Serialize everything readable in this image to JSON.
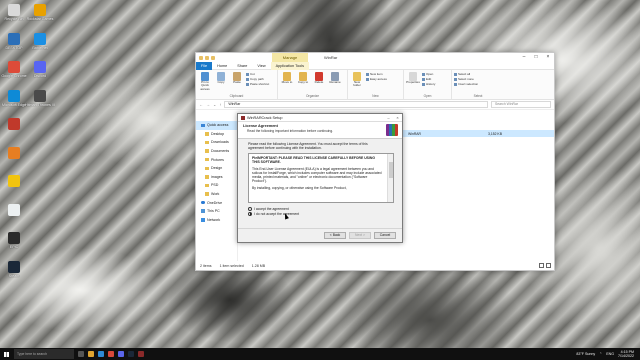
{
  "desktop": {
    "icons": [
      {
        "label": "Recycle Bin",
        "color": "#d9d9d9"
      },
      {
        "label": "Rockstar Games",
        "color": "#e8a100"
      },
      {
        "label": "DESKTOP",
        "color": "#2c6fb8"
      },
      {
        "label": "Battle.net",
        "color": "#1a8fe3"
      },
      {
        "label": "Google Chrome",
        "color": "#dd4b39"
      },
      {
        "label": "Discord",
        "color": "#5865f2"
      },
      {
        "label": "Microsoft Edge",
        "color": "#0e8ad6"
      },
      {
        "label": "Hitman Thrones III",
        "color": "#4a4a4a"
      },
      {
        "label": "",
        "color": "#c0392b"
      },
      {
        "label": "",
        "color": "#e67e22"
      },
      {
        "label": "",
        "color": "#f1c40f"
      },
      {
        "label": "",
        "color": "#ecf0f1"
      },
      {
        "label": "EPIC",
        "color": "#2b2b2b"
      },
      {
        "label": "Steam",
        "color": "#1b2838"
      }
    ]
  },
  "explorer": {
    "title": "WinRar",
    "manage_tab": "Manage",
    "app_tools": "Application Tools",
    "tabs": [
      "File",
      "Home",
      "Share",
      "View",
      "Application Tools"
    ],
    "ribbon": {
      "clipboard": {
        "pin": "Pin to Quick access",
        "copy": "Copy",
        "paste": "Paste",
        "cut": "Cut",
        "copy_path": "Copy path",
        "paste_shortcut": "Paste shortcut",
        "group": "Clipboard"
      },
      "organize": {
        "move_to": "Move to",
        "copy_to": "Copy to",
        "delete": "Delete",
        "rename": "Rename",
        "group": "Organize"
      },
      "new": {
        "new_folder": "New folder",
        "new_item": "New item",
        "easy_access": "Easy access",
        "group": "New"
      },
      "open": {
        "properties": "Properties",
        "open": "Open",
        "edit": "Edit",
        "history": "History",
        "group": "Open"
      },
      "select": {
        "select_all": "Select all",
        "select_none": "Select none",
        "invert": "Invert selection",
        "group": "Select"
      }
    },
    "address": "WinRar",
    "search_placeholder": "Search WinRar",
    "nav": [
      {
        "label": "Quick access",
        "kind": "quick"
      },
      {
        "label": "Desktop",
        "kind": "folder"
      },
      {
        "label": "Downloads",
        "kind": "folder"
      },
      {
        "label": "Documents",
        "kind": "folder"
      },
      {
        "label": "Pictures",
        "kind": "folder"
      },
      {
        "label": "Design",
        "kind": "folder"
      },
      {
        "label": "images",
        "kind": "folder"
      },
      {
        "label": "PSD",
        "kind": "folder"
      },
      {
        "label": "Work",
        "kind": "folder"
      },
      {
        "label": "OneDrive",
        "kind": "onedrive"
      },
      {
        "label": "This PC",
        "kind": "pc"
      },
      {
        "label": "Network",
        "kind": "net"
      }
    ],
    "file": {
      "name": "WinRAR",
      "size": "3,152 KB"
    },
    "status": {
      "items": "2 items",
      "selected": "1 item selected",
      "size": "1.28 MB"
    }
  },
  "dialog": {
    "title": "WinRARCrack Setup",
    "header_title": "License Agreement",
    "header_sub": "Read the following important information before continuing.",
    "intro": "Please read the following License Agreement. You must accept the terms of this agreement before continuing with the installation.",
    "eula": [
      "PleIMPORTANT: PLEASE READ THIS LICENSE CAREFULLY BEFORE USING THIS SOFTWARE.",
      "This End-User License Agreement (EULA) is a legal agreement between you and solicus for InstallForge, which includes computer software and may include associated media, printed materials, and \"online\" or electronic documentation (\"Software Product\").",
      "By installing, copying, or otherwise using the Software Product,"
    ],
    "accept": "I accept the agreement",
    "decline": "I do not accept the agreement",
    "back": "< Back",
    "next": "Next >",
    "cancel": "Cancel"
  },
  "taskbar": {
    "search_placeholder": "Type here to search",
    "weather": "83°F Sunny",
    "lang": "ENG",
    "time": "4:15 PM",
    "date": "7/14/2022"
  }
}
